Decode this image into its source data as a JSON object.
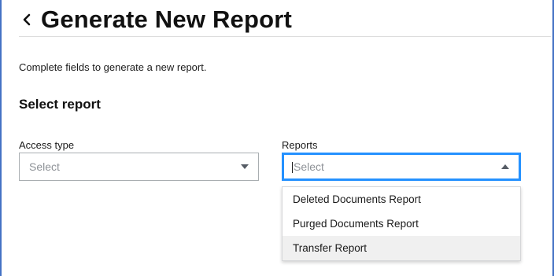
{
  "header": {
    "back_icon": "chevron-left-icon",
    "title": "Generate New Report"
  },
  "intro_text": "Complete fields to generate a new report.",
  "section_title": "Select report",
  "access_type": {
    "label": "Access type",
    "placeholder": "Select",
    "icon": "caret-down-icon"
  },
  "reports": {
    "label": "Reports",
    "placeholder": "Select",
    "icon": "caret-up-icon",
    "focus_color": "#2491ff",
    "options": [
      {
        "label": "Deleted Documents Report"
      },
      {
        "label": "Purged Documents Report"
      },
      {
        "label": "Transfer Report"
      }
    ],
    "highlighted_option": "Transfer Report"
  }
}
